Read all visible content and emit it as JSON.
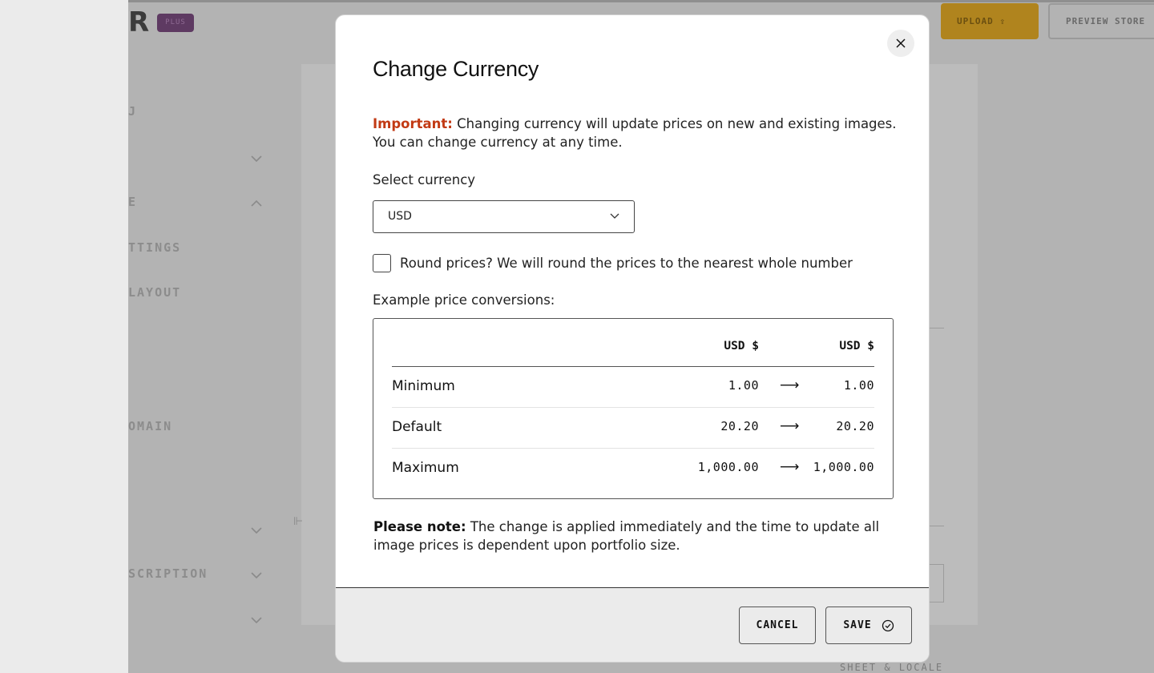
{
  "background_app": {
    "logo_letter": "R",
    "plus_badge": "PLUS",
    "upload_label": "UPLOAD ⇪",
    "preview_label": "PREVIEW STORE",
    "sidebar": [
      {
        "label": "J"
      },
      {
        "label": "E"
      },
      {
        "label": "TTINGS"
      },
      {
        "label": "LAYOUT"
      },
      {
        "label": "OMAIN"
      },
      {
        "label": "SCRIPTION"
      }
    ],
    "bottom_text": "SHEET & LOCALE"
  },
  "modal": {
    "title": "Change Currency",
    "important_label": "Important:",
    "important_text": " Changing currency will update prices on new and existing images. You can change currency at any time.",
    "select_label": "Select currency",
    "select_value": "USD",
    "round_checked": false,
    "round_label": "Round prices? We will round the prices to the nearest whole number",
    "example_label": "Example price conversions:",
    "table": {
      "headers": [
        "USD $",
        "USD $"
      ],
      "arrow": "⟶",
      "rows": [
        {
          "label": "Minimum",
          "from": "1.00",
          "to": "1.00"
        },
        {
          "label": "Default",
          "from": "20.20",
          "to": "20.20"
        },
        {
          "label": "Maximum",
          "from": "1,000.00",
          "to": "1,000.00"
        }
      ]
    },
    "note_label": "Please note:",
    "note_text": " The change is applied immediately and the time to update all image prices is dependent upon portfolio size.",
    "cancel_label": "CANCEL",
    "save_label": "SAVE"
  }
}
